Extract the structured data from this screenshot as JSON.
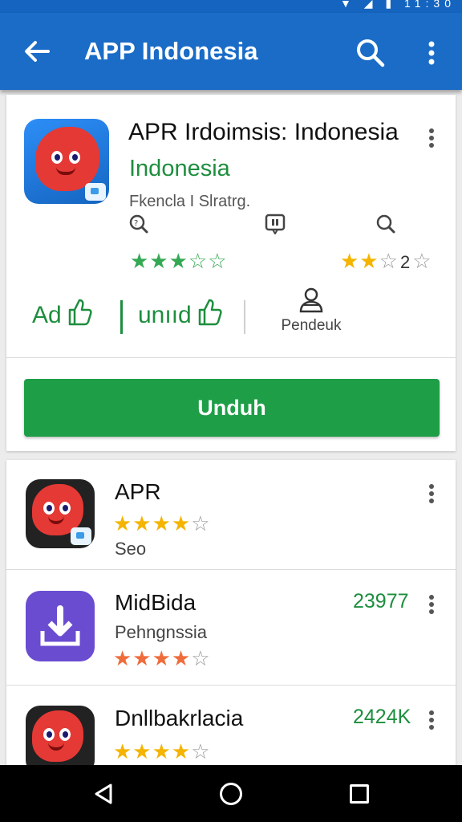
{
  "appbar": {
    "title": "APP Indonesia",
    "back_icon": "arrow-left-icon",
    "search_icon": "search-icon",
    "more_icon": "more-vert-icon"
  },
  "status": {
    "icons": "▼ ◢ ▮ 11:30"
  },
  "featured": {
    "title": "APR Irdoimsis: Indonesia",
    "subtitle": "Indonesia",
    "developer": "Fkencla I Slratrg.",
    "rating_stars_left": "★★★☆☆",
    "rating_stars_right_on": "★★",
    "rating_stars_right_off": "☆",
    "rating_count": "2",
    "rating_stars_right_end": "☆",
    "actions": [
      {
        "label": "Ad",
        "icon": "thumbs-up-icon"
      },
      {
        "label": "unııd",
        "icon": "thumbs-up-icon"
      },
      {
        "label": "Pendeuk",
        "icon": "person-icon"
      }
    ],
    "install_label": "Unduh"
  },
  "list": [
    {
      "title": "APR",
      "stars_on": "★★★★",
      "stars_off": "☆",
      "sub": "Seo",
      "count": ""
    },
    {
      "title": "MidBida",
      "sub": "Pehngnssia",
      "stars_on": "★★★★",
      "stars_off": "☆",
      "count": "23977"
    },
    {
      "title": "Dnllbakrlacia",
      "stars_on": "★★★★",
      "stars_off": "☆",
      "sub": "",
      "count": "2424K"
    }
  ],
  "colors": {
    "appbar": "#1a6cc7",
    "accent_green": "#1e9e47",
    "star_gold": "#f4b400"
  }
}
